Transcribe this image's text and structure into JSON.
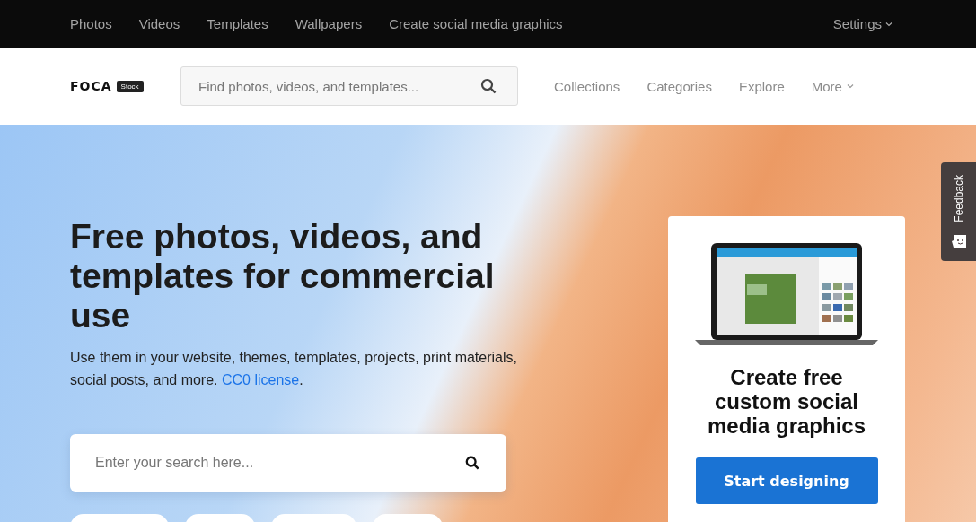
{
  "top_nav": {
    "links": [
      "Photos",
      "Videos",
      "Templates",
      "Wallpapers",
      "Create social media graphics"
    ],
    "settings": "Settings"
  },
  "header": {
    "logo": "FOCA",
    "logo_badge": "Stock",
    "search": {
      "placeholder": "Find photos, videos, and templates..."
    },
    "links": [
      "Collections",
      "Categories",
      "Explore"
    ],
    "more": "More"
  },
  "hero": {
    "title": "Free photos, videos, and templates for commercial use",
    "subtitle": "Use them in your website, themes, templates, projects, print materials, social posts, and more. ",
    "subtitle_link": "CC0 license",
    "subtitle_end": ".",
    "search": {
      "placeholder": "Enter your search here..."
    }
  },
  "promo_card": {
    "title": "Create free custom social media graphics",
    "button": "Start designing"
  },
  "feedback_tab": {
    "label": "Feedback"
  }
}
